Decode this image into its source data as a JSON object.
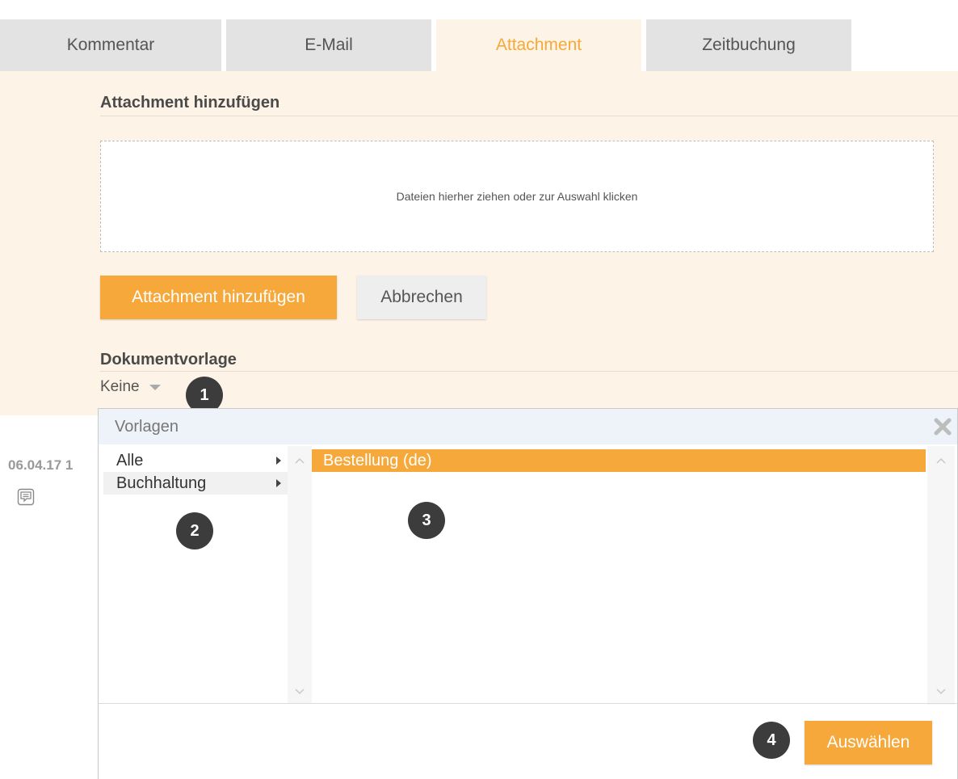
{
  "tabs": [
    {
      "label": "Kommentar",
      "active": false
    },
    {
      "label": "E-Mail",
      "active": false
    },
    {
      "label": "Attachment",
      "active": true
    },
    {
      "label": "Zeitbuchung",
      "active": false
    }
  ],
  "attachment": {
    "section_title": "Attachment hinzufügen",
    "dropzone_text": "Dateien hierher ziehen oder zur Auswahl klicken",
    "add_button": "Attachment hinzufügen",
    "cancel_button": "Abbrechen"
  },
  "document_template": {
    "section_title": "Dokumentvorlage",
    "selected_value": "Keine"
  },
  "sidebar": {
    "date": "06.04.17 1"
  },
  "modal": {
    "title": "Vorlagen",
    "categories": [
      {
        "label": "Alle"
      },
      {
        "label": "Buchhaltung"
      }
    ],
    "templates": [
      {
        "label": "Bestellung (de)",
        "selected": true
      }
    ],
    "select_button": "Auswählen"
  },
  "badges": [
    "1",
    "2",
    "3",
    "4"
  ],
  "colors": {
    "accent": "#f7a83a",
    "panel_bg": "#fdf3e7",
    "tab_bg": "#e3e3e3",
    "badge_bg": "#3c3c3c"
  }
}
